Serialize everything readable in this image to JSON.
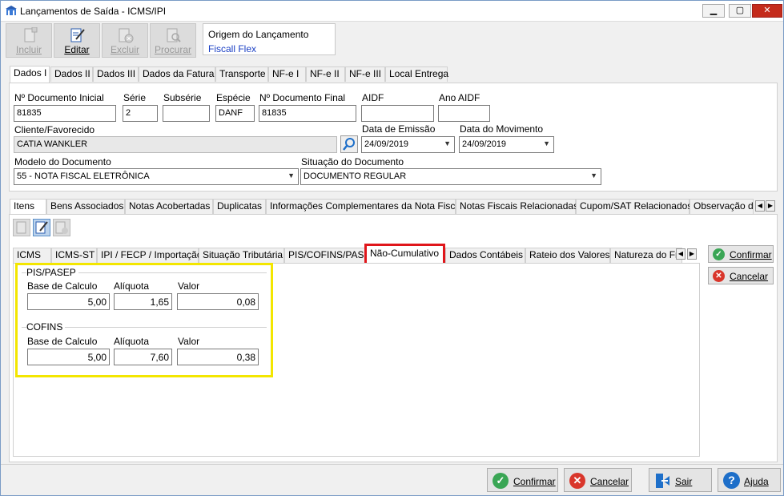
{
  "window": {
    "title": "Lançamentos de Saída - ICMS/IPI",
    "minimize_icon": "▁",
    "restore_icon": "▢",
    "close_icon": "✕"
  },
  "toolbar": {
    "incluir": "Incluir",
    "editar": "Editar",
    "excluir": "Excluir",
    "procurar": "Procurar"
  },
  "origem": {
    "label": "Origem do Lançamento",
    "value": "Fiscall Flex"
  },
  "main_tabs": [
    "Dados I",
    "Dados II",
    "Dados III",
    "Dados da Fatura",
    "Transporte",
    "NF-e I",
    "NF-e II",
    "NF-e III",
    "Local Entrega"
  ],
  "dados": {
    "num_doc_inicial_label": "Nº Documento Inicial",
    "num_doc_inicial": "81835",
    "serie_label": "Série",
    "serie": "2",
    "subserie_label": "Subsérie",
    "subserie": "",
    "especie_label": "Espécie",
    "especie": "DANF",
    "num_doc_final_label": "Nº Documento Final",
    "num_doc_final": "81835",
    "aidf_label": "AIDF",
    "aidf": "",
    "ano_aidf_label": "Ano AIDF",
    "ano_aidf": "",
    "cliente_label": "Cliente/Favorecido",
    "cliente": "CATIA WANKLER",
    "data_emissao_label": "Data de Emissão",
    "data_emissao": "24/09/2019",
    "data_movimento_label": "Data do Movimento",
    "data_movimento": "24/09/2019",
    "modelo_label": "Modelo do Documento",
    "modelo": "55 - NOTA FISCAL ELETRÔNICA",
    "situacao_label": "Situação do Documento",
    "situacao": "DOCUMENTO REGULAR"
  },
  "item_tabs": [
    "Itens",
    "Bens Associados",
    "Notas Acobertadas",
    "Duplicatas",
    "Informações Complementares da Nota Fiscal",
    "Notas Fiscais Relacionadas",
    "Cupom/SAT Relacionados",
    "Observação do"
  ],
  "sub_tabs": [
    "ICMS",
    "ICMS-ST",
    "IPI / FECP / Importação",
    "Situação Tributária",
    "PIS/COFINS/PASEP",
    "Não-Cumulativo",
    "Dados Contábeis",
    "Rateio dos Valores",
    "Natureza do Fr"
  ],
  "pis": {
    "title": "PIS/PASEP",
    "base_label": "Base de Calculo",
    "base": "5,00",
    "aliquota_label": "Alíquota",
    "aliquota": "1,65",
    "valor_label": "Valor",
    "valor": "0,08"
  },
  "cofins": {
    "title": "COFINS",
    "base_label": "Base de Calculo",
    "base": "5,00",
    "aliquota_label": "Alíquota",
    "aliquota": "7,60",
    "valor_label": "Valor",
    "valor": "0,38"
  },
  "side_buttons": {
    "confirmar": "Confirmar",
    "cancelar": "Cancelar"
  },
  "bottom_buttons": {
    "confirmar": "Confirmar",
    "cancelar": "Cancelar",
    "sair": "Sair",
    "ajuda": "Ajuda"
  },
  "colors": {
    "highlight_red": "#e0161b",
    "highlight_yellow": "#f3e600",
    "link_blue": "#1a3fc4",
    "confirm_green": "#3aa655",
    "cancel_red": "#d9362b",
    "help_blue": "#1e6fc9"
  }
}
